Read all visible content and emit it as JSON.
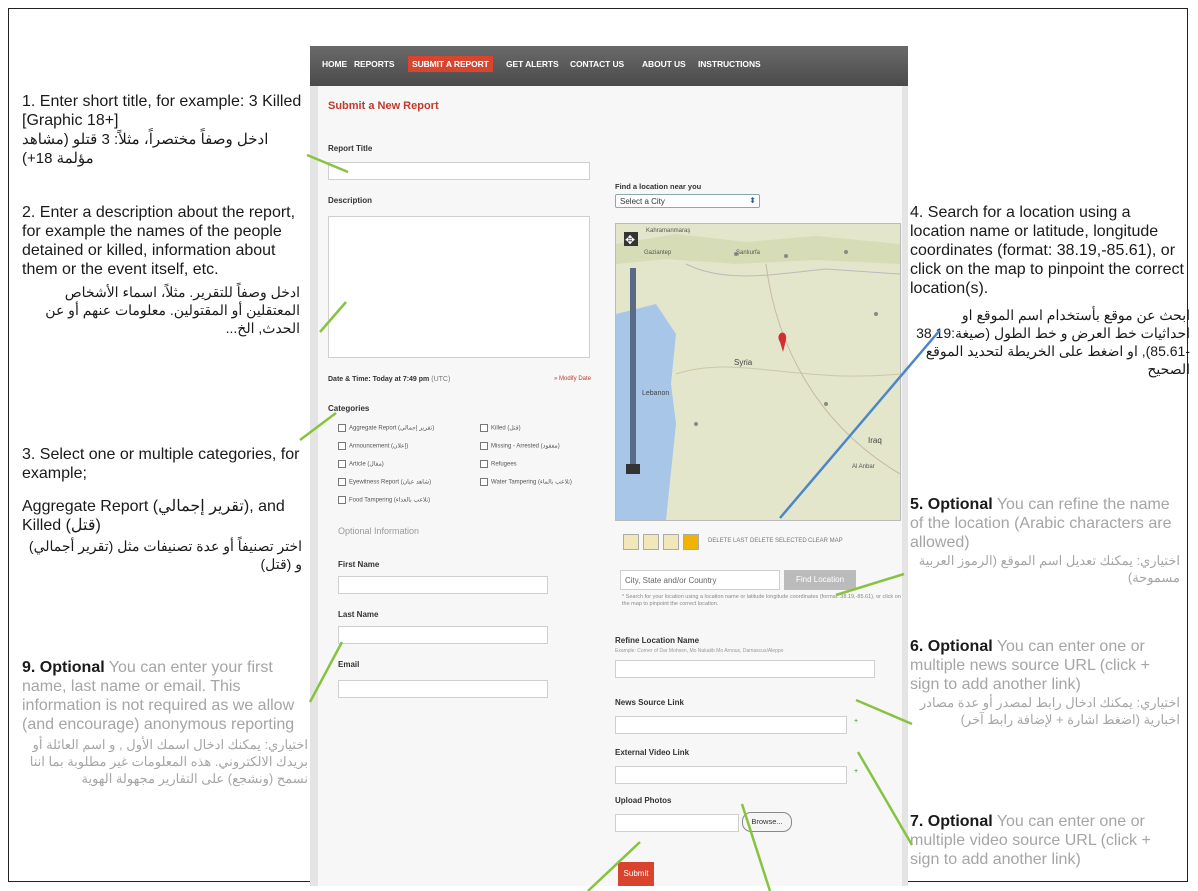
{
  "nav": {
    "items": [
      "HOME",
      "REPORTS",
      "SUBMIT A REPORT",
      "GET ALERTS",
      "CONTACT US",
      "ABOUT US",
      "INSTRUCTIONS"
    ],
    "active_index": 2
  },
  "form": {
    "page_title": "Submit a New Report",
    "report_title_label": "Report Title",
    "description_label": "Description",
    "datetime_label": "Date & Time: Today at 7:49 pm",
    "datetime_tz": "(UTC)",
    "modify_label": "» Modify Date",
    "categories_label": "Categories",
    "categories": [
      "Aggregate Report (تقرير إجمالي)",
      "Announcement (إعلان)",
      "Article (مقال)",
      "Eyewitness Report (شاهد عيان)",
      "Food Tampering (تلاعب بالغذاء)",
      "Killed (قتل)",
      "Missing - Arrested (مفقود)",
      "Refugees",
      "Water Tampering (تلاعب بالماء)"
    ],
    "optional_header": "Optional Information",
    "first_name_label": "First Name",
    "last_name_label": "Last Name",
    "email_label": "Email",
    "submit_label": "Submit"
  },
  "location": {
    "find_label": "Find a location near you",
    "city_select": "Select a City",
    "map_labels": [
      "Kahramanmaraş",
      "Gaziantep",
      "Şanlıurfa",
      "Syria",
      "Lebanon",
      "Iraq",
      "Al Anbar"
    ],
    "toolbar": [
      "DELETE LAST",
      "DELETE SELECTED",
      "CLEAR MAP"
    ],
    "search_placeholder": "City, State and/or Country",
    "find_button": "Find Location",
    "search_hint": "* Search for your location using a location name or latitude longitude coordinates (format: 38.19,-85.61), or click on the map to pinpoint the correct location.",
    "refine_label": "Refine Location Name",
    "refine_hint": "Example: Corner of Dar Mohsen, Mo Nakatib Mo Arnous, Damascus/Aleppo",
    "news_label": "News Source Link",
    "video_label": "External Video Link",
    "photos_label": "Upload Photos",
    "browse_label": "Browse...",
    "plus": "+"
  },
  "annotations": {
    "a1_en": "1. Enter short title, for example: 3 Killed [Graphic 18+]",
    "a1_ar": "ادخل وصفاً مختصراً، مثلاً: 3 قتلو (مشاهد مؤلمة 18+)",
    "a2_en": "2. Enter a description about the report, for example the names of the people detained or killed, information about them or the event itself, etc.",
    "a2_ar": "ادخل وصفاً للتقرير. مثلاً، اسماء الأشخاص المعتقلين أو المقتولين. معلومات عنهم أو عن الحدث, الخ...",
    "a3_en": "3. Select one or multiple categories, for example;",
    "a3_en2": "Aggregate Report (تقرير إجمالي), and Killed (قتل)",
    "a3_ar": "اختر تصنيفاً أو عدة تصنيفات مثل (تقرير أجمالي) و (قتل)",
    "a4_en": "4. Search for a location using a location name or latitude, longitude coordinates (format: 38.19,-85.61), or click on the map to pinpoint the correct location(s).",
    "a4_ar": "ابحث عن موقع بأستخدام اسم الموقع او احداثيات خط العرض و خط الطول (صيغة:38.19 -85.61), او اضغط على الخريطة لتحديد الموقع الصحيح",
    "a5_bold": "5. Optional",
    "a5_en": "You can refine the name of the location (Arabic characters are allowed)",
    "a5_ar": "اختياري: يمكنك تعديل اسم الموقع (الرموز العربية مسموحة)",
    "a6_bold": "6. Optional",
    "a6_en": "You can enter one or multiple news source URL (click + sign to add another link)",
    "a6_ar": "اختياري: يمكنك ادخال رابط لمصدر أو عدة مصادر اخبارية (اضغط اشارة + لإضافة رابط آخر)",
    "a7_bold": "7. Optional",
    "a7_en": "You can enter one or multiple video source URL (click + sign to add another link)",
    "a9_bold": "9. Optional",
    "a9_en": "You can enter your first name, last name or email. This information is not required as we allow (and encourage) anonymous reporting",
    "a9_ar": "اختياري: يمكنك ادخال اسمك الأول , و اسم العائلة أو بريدك الالكتروني. هذه المعلومات غير مطلوبة بما اننا نسمح (ونشجع) على التقارير مجهولة الهوية"
  },
  "colors": {
    "accent": "#d9442e",
    "nav_bg": "#555555",
    "pointer_green": "#86c440",
    "pointer_blue": "#4a86c8",
    "annotation_gray": "#a5a5a5"
  }
}
